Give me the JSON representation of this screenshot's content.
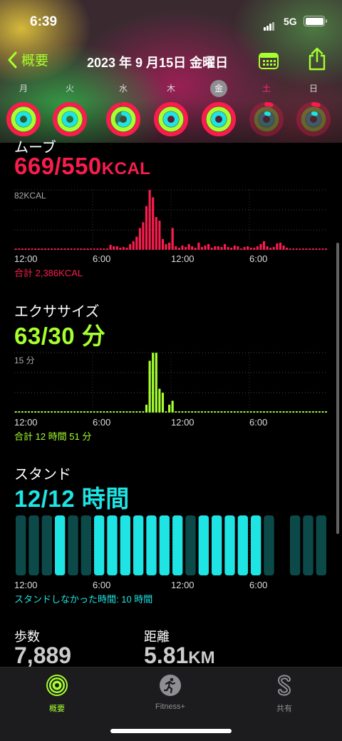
{
  "status": {
    "time": "6:39",
    "network": "5G"
  },
  "nav": {
    "back_label": "概要",
    "title": "2023 年 9 月15日 金曜日"
  },
  "week": [
    {
      "label": "月",
      "state": "complete"
    },
    {
      "label": "火",
      "state": "complete"
    },
    {
      "label": "水",
      "state": "partial"
    },
    {
      "label": "木",
      "state": "complete"
    },
    {
      "label": "金",
      "state": "today"
    },
    {
      "label": "土",
      "state": "dim"
    },
    {
      "label": "日",
      "state": "dim"
    }
  ],
  "move": {
    "title": "ムーブ",
    "value": "669/550",
    "unit": "KCAL",
    "axis_max": "82KCAL",
    "x_labels": [
      "12:00",
      "6:00",
      "12:00",
      "6:00"
    ],
    "total": "合計 2,386KCAL",
    "color": "#fa1c4d"
  },
  "exercise": {
    "title": "エクササイズ",
    "value": "63/30",
    "unit": "分",
    "axis_max": "15 分",
    "x_labels": [
      "12:00",
      "6:00",
      "12:00",
      "6:00"
    ],
    "total": "合計 12 時間 51 分",
    "color": "#a6ff2e"
  },
  "stand": {
    "title": "スタンド",
    "value": "12/12 時間",
    "x_labels": [
      "12:00",
      "6:00",
      "12:00",
      "6:00"
    ],
    "note": "スタンドしなかった時間: 10 時間",
    "color": "#1ee4e4"
  },
  "stats": {
    "steps_label": "歩数",
    "steps_value": "7,889",
    "distance_label": "距離",
    "distance_value": "5.81",
    "distance_unit": "KM"
  },
  "tabs": [
    {
      "label": "概要",
      "icon": "activity-rings-icon",
      "active": true
    },
    {
      "label": "Fitness+",
      "icon": "runner-icon",
      "active": false
    },
    {
      "label": "共有",
      "icon": "sharing-icon",
      "active": false
    }
  ],
  "chart_data": [
    {
      "type": "bar",
      "title": "ムーブ",
      "ylabel": "82KCAL",
      "x": [
        0,
        1,
        2,
        3,
        4,
        5,
        6,
        7,
        8,
        9,
        10,
        11,
        12,
        13,
        14,
        15,
        16,
        17,
        18,
        19,
        20,
        21,
        22,
        23,
        24,
        25,
        26,
        27,
        28,
        29,
        30,
        31,
        32,
        33,
        34,
        35,
        36,
        37,
        38,
        39,
        40,
        41,
        42,
        43,
        44,
        45,
        46,
        47,
        48,
        49,
        50,
        51,
        52,
        53,
        54,
        55,
        56,
        57,
        58,
        59,
        60,
        61,
        62,
        63,
        64,
        65,
        66,
        67,
        68,
        69,
        70,
        71,
        72,
        73,
        74,
        75,
        76,
        77,
        78,
        79,
        80,
        81,
        82,
        83,
        84,
        85,
        86,
        87,
        88,
        89,
        90,
        91,
        92,
        93,
        94,
        95
      ],
      "values": [
        2,
        2,
        2,
        2,
        2,
        2,
        2,
        2,
        2,
        2,
        2,
        2,
        2,
        2,
        2,
        2,
        2,
        2,
        2,
        2,
        2,
        2,
        2,
        2,
        2,
        2,
        2,
        2,
        2,
        7,
        5,
        5,
        3,
        4,
        3,
        8,
        12,
        18,
        30,
        38,
        60,
        82,
        72,
        45,
        40,
        15,
        8,
        10,
        30,
        5,
        3,
        6,
        4,
        8,
        5,
        3,
        10,
        4,
        6,
        8,
        3,
        5,
        5,
        4,
        8,
        4,
        3,
        6,
        5,
        2,
        4,
        5,
        3,
        3,
        5,
        8,
        12,
        5,
        3,
        4,
        9,
        10,
        6,
        3,
        2,
        2,
        2,
        2,
        2,
        2,
        2,
        2,
        2,
        2,
        2,
        2
      ],
      "ylim": [
        0,
        82
      ]
    },
    {
      "type": "bar",
      "title": "エクササイズ",
      "ylabel": "15 分",
      "x": [
        0,
        1,
        2,
        3,
        4,
        5,
        6,
        7,
        8,
        9,
        10,
        11,
        12,
        13,
        14,
        15,
        16,
        17,
        18,
        19,
        20,
        21,
        22,
        23,
        24,
        25,
        26,
        27,
        28,
        29,
        30,
        31,
        32,
        33,
        34,
        35,
        36,
        37,
        38,
        39,
        40,
        41,
        42,
        43,
        44,
        45,
        46,
        47,
        48,
        49,
        50,
        51,
        52,
        53,
        54,
        55,
        56,
        57,
        58,
        59,
        60,
        61,
        62,
        63,
        64,
        65,
        66,
        67,
        68,
        69,
        70,
        71,
        72,
        73,
        74,
        75,
        76,
        77,
        78,
        79,
        80,
        81,
        82,
        83,
        84,
        85,
        86,
        87,
        88,
        89,
        90,
        91,
        92,
        93,
        94,
        95
      ],
      "values": [
        0,
        0,
        0,
        0,
        0,
        0,
        0,
        0,
        0,
        0,
        0,
        0,
        0,
        0,
        0,
        0,
        0,
        0,
        0,
        0,
        0,
        0,
        0,
        0,
        0,
        0,
        0,
        0,
        0,
        0,
        0,
        0,
        0,
        0,
        0,
        0,
        0,
        0,
        0,
        0,
        2,
        13,
        15,
        15,
        6,
        5,
        0,
        2,
        3,
        0,
        0,
        0,
        0,
        0,
        0,
        0,
        0,
        0,
        0,
        0,
        0,
        0,
        0,
        0,
        0,
        0,
        0,
        0,
        0,
        0,
        0,
        0,
        0,
        0,
        0,
        0,
        0,
        0,
        0,
        0,
        0,
        0,
        0,
        0,
        0,
        0,
        0,
        0,
        0,
        0,
        0,
        0,
        0,
        0,
        0,
        0
      ],
      "ylim": [
        0,
        15
      ]
    },
    {
      "type": "bar",
      "title": "スタンド",
      "categories": [
        "0",
        "1",
        "2",
        "3",
        "4",
        "5",
        "6",
        "7",
        "8",
        "9",
        "10",
        "11",
        "12",
        "13",
        "14",
        "15",
        "16",
        "17",
        "18",
        "19",
        "20",
        "21",
        "22",
        "23"
      ],
      "values": [
        0,
        0,
        0,
        1,
        0,
        0,
        1,
        1,
        1,
        1,
        1,
        1,
        1,
        0,
        1,
        1,
        1,
        1,
        1,
        0,
        null,
        0,
        0,
        0
      ]
    }
  ]
}
